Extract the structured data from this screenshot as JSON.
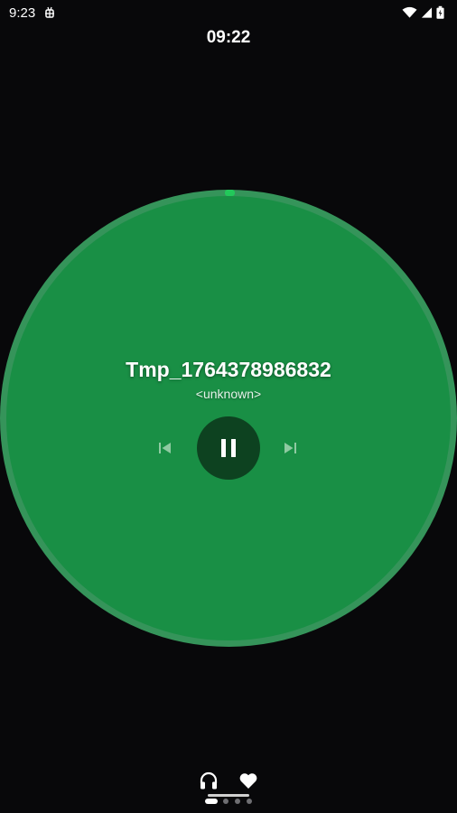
{
  "status_bar": {
    "time": "9:23",
    "notification_icon": "bug-icon",
    "wifi_icon": "wifi-icon",
    "signal_icon": "cellular-signal-icon",
    "battery_icon": "battery-charging-icon"
  },
  "clock": {
    "time": "09:22"
  },
  "player": {
    "title": "Tmp_1764378986832",
    "artist": "<unknown>",
    "state": "playing",
    "progress_fraction": 0.0,
    "accent_color": "#198f45",
    "ring_color": "#35945a",
    "play_button_color": "#0d4220",
    "controls": {
      "previous_icon": "skip-previous-icon",
      "pause_icon": "pause-icon",
      "next_icon": "skip-next-icon"
    }
  },
  "bottom_bar": {
    "left_icon": "headphones-icon",
    "right_icon": "heart-icon",
    "pages": 4,
    "current_page": 1
  }
}
